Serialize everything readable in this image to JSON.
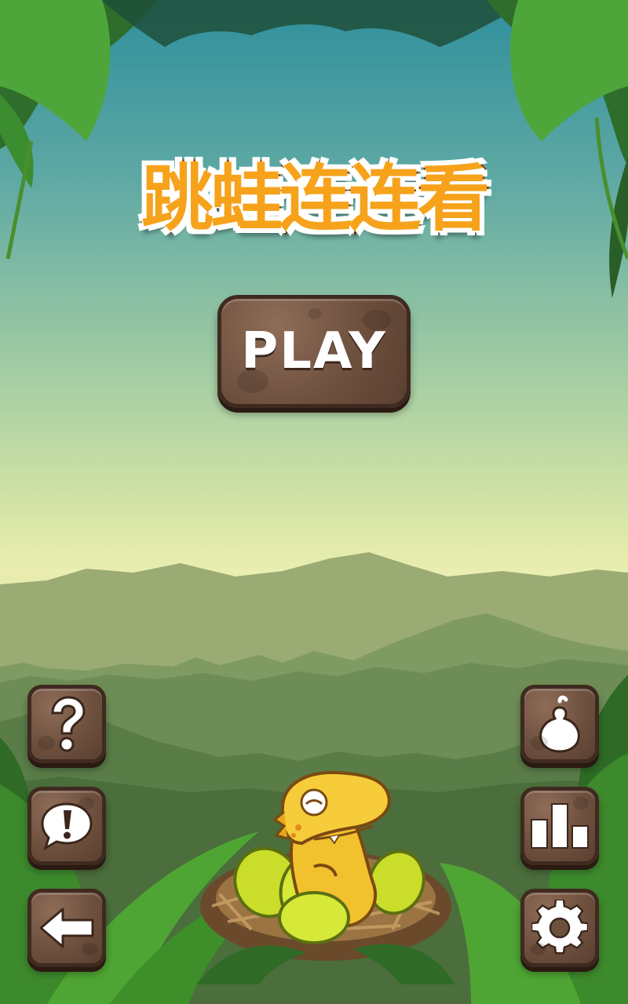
{
  "game": {
    "title": "跳蛙连连看",
    "play_label": "PLAY"
  },
  "left_buttons": [
    {
      "name": "help-button",
      "icon": "question-icon"
    },
    {
      "name": "feedback-button",
      "icon": "exclamation-speech-icon"
    },
    {
      "name": "back-button",
      "icon": "arrow-left-icon"
    }
  ],
  "right_buttons": [
    {
      "name": "shop-button",
      "icon": "gourd-icon"
    },
    {
      "name": "leaderboard-button",
      "icon": "bar-chart-icon"
    },
    {
      "name": "settings-button",
      "icon": "gear-icon"
    }
  ],
  "colors": {
    "button_brown": "#6e503e",
    "title_orange": "#f6a21b",
    "dino_yellow": "#f2c12e",
    "egg_green": "#c9dd2a"
  }
}
